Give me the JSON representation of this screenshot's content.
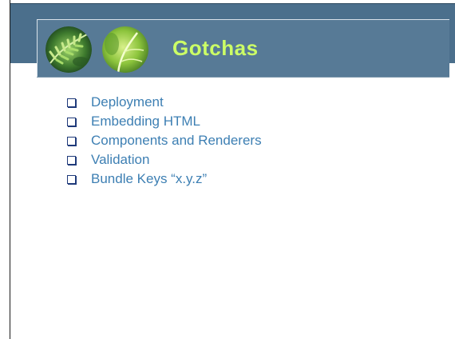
{
  "slide": {
    "title": "Gotchas",
    "bullets": [
      "Deployment",
      "Embedding HTML",
      "Components and Renderers",
      "Validation",
      "Bundle Keys “x.y.z”"
    ]
  },
  "colors": {
    "header_band": "#4b6f8c",
    "title_box": "#577a96",
    "title_text": "#ccff66",
    "bullet_text": "#3d7fb3",
    "checkbox": "#1f3a7a"
  },
  "icons": [
    "fern-leaf-image",
    "green-leaf-image",
    "checkbox-bullet-icon"
  ]
}
